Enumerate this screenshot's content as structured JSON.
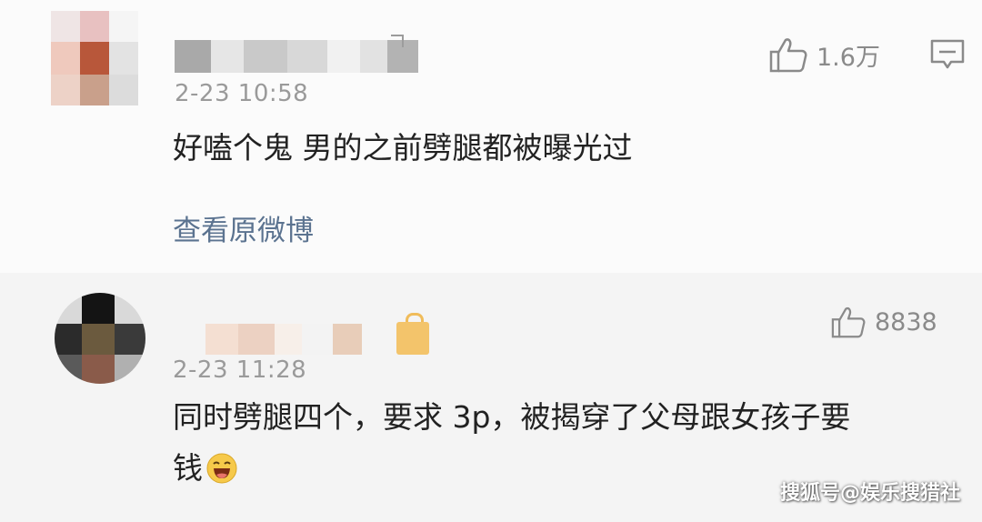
{
  "comments": [
    {
      "timestamp": "2-23 10:58",
      "likes": "1.6万",
      "text": "好嗑个鬼 男的之前劈腿都被曝光过",
      "view_original": "查看原微博"
    },
    {
      "timestamp": "2-23 11:28",
      "likes": "8838",
      "text_line1": "同时劈腿四个，要求 3p，被揭穿了父母跟女孩子要",
      "text_line2": "钱"
    }
  ],
  "icons": {
    "like": "thumbs-up-icon",
    "reply": "comment-icon",
    "emoji": "laughing-emoji-icon",
    "badge": "gold-badge-icon"
  },
  "colors": {
    "link": "#5b7390",
    "meta": "#9a9a9a",
    "text": "#222222",
    "badge": "#f3c46b"
  },
  "watermark": "搜狐号@娱乐搜猎社"
}
